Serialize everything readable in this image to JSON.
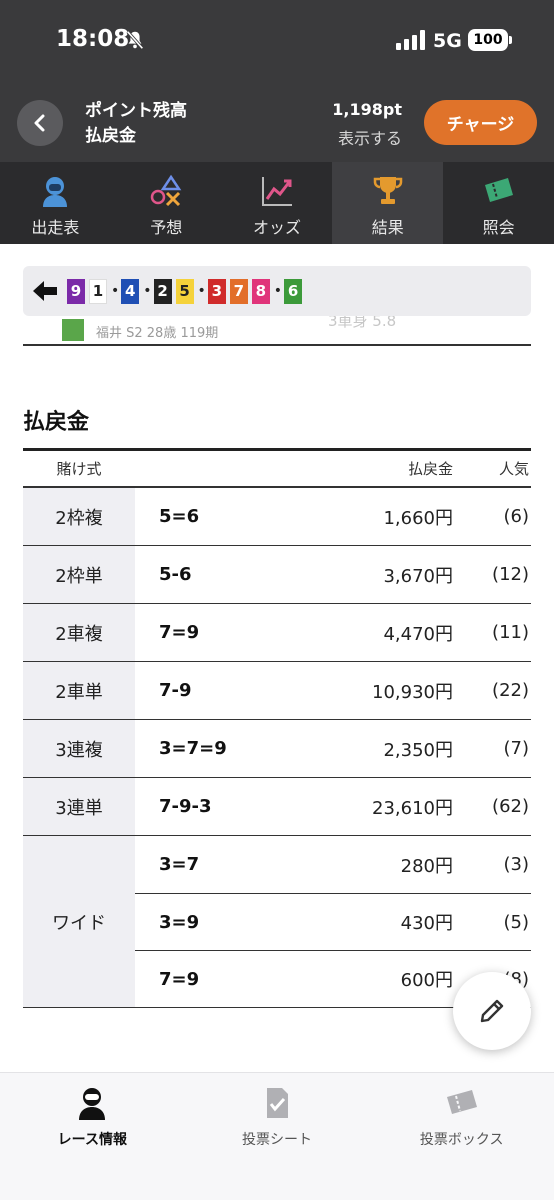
{
  "status_bar": {
    "time": "18:08",
    "network": "5G",
    "battery": "100"
  },
  "header": {
    "point_label": "ポイント残高",
    "payout_label": "払戻金",
    "points_value": "1,198pt",
    "show_label": "表示する",
    "charge_button": "チャージ"
  },
  "tabs": [
    {
      "label": "出走表",
      "icon": "racer-icon",
      "active": false
    },
    {
      "label": "予想",
      "icon": "prediction-icon",
      "active": false
    },
    {
      "label": "オッズ",
      "icon": "odds-chart-icon",
      "active": false
    },
    {
      "label": "結果",
      "icon": "trophy-icon",
      "active": true
    },
    {
      "label": "照会",
      "icon": "ticket-icon",
      "active": false
    }
  ],
  "order_strip": {
    "chips": [
      {
        "n": "9",
        "bg": "#7b2aa8",
        "fg": "#ffffff"
      },
      {
        "n": "1",
        "bg": "#ffffff",
        "fg": "#222222"
      },
      {
        "n": "4",
        "bg": "#1f4fb4",
        "fg": "#ffffff"
      },
      {
        "n": "2",
        "bg": "#222222",
        "fg": "#ffffff"
      },
      {
        "n": "5",
        "bg": "#f5d23a",
        "fg": "#222222"
      },
      {
        "n": "3",
        "bg": "#d02b2b",
        "fg": "#ffffff"
      },
      {
        "n": "7",
        "bg": "#e26e2a",
        "fg": "#ffffff"
      },
      {
        "n": "8",
        "bg": "#e0347a",
        "fg": "#ffffff"
      },
      {
        "n": "6",
        "bg": "#3c9a3a",
        "fg": "#ffffff"
      }
    ],
    "dot_after": [
      1,
      2,
      4,
      7
    ]
  },
  "behind_row": {
    "text": "福井 S2 28歳 119期",
    "ghost_text": "3車身            5.8"
  },
  "payout": {
    "title": "払戻金",
    "headers": {
      "type": "賭け式",
      "payout": "払戻金",
      "popularity": "人気"
    },
    "groups": [
      {
        "type": "2枠複",
        "rows": [
          {
            "combo": "5=6",
            "payout": "1,660円",
            "pop": "(6)"
          }
        ]
      },
      {
        "type": "2枠単",
        "rows": [
          {
            "combo": "5-6",
            "payout": "3,670円",
            "pop": "(12)"
          }
        ]
      },
      {
        "type": "2車複",
        "rows": [
          {
            "combo": "7=9",
            "payout": "4,470円",
            "pop": "(11)"
          }
        ]
      },
      {
        "type": "2車単",
        "rows": [
          {
            "combo": "7-9",
            "payout": "10,930円",
            "pop": "(22)"
          }
        ]
      },
      {
        "type": "3連複",
        "rows": [
          {
            "combo": "3=7=9",
            "payout": "2,350円",
            "pop": "(7)"
          }
        ]
      },
      {
        "type": "3連単",
        "rows": [
          {
            "combo": "7-9-3",
            "payout": "23,610円",
            "pop": "(62)"
          }
        ]
      },
      {
        "type": "ワイド",
        "rows": [
          {
            "combo": "3=7",
            "payout": "280円",
            "pop": "(3)"
          },
          {
            "combo": "3=9",
            "payout": "430円",
            "pop": "(5)"
          },
          {
            "combo": "7=9",
            "payout": "600円",
            "pop": "(8)"
          }
        ]
      }
    ]
  },
  "bottom_nav": [
    {
      "label": "レース情報",
      "icon": "race-info-icon",
      "active": true
    },
    {
      "label": "投票シート",
      "icon": "vote-sheet-icon",
      "active": false
    },
    {
      "label": "投票ボックス",
      "icon": "vote-box-icon",
      "active": false
    }
  ],
  "colors": {
    "accent": "#e0732a",
    "header_bg": "#3a3a3c",
    "tab_bg": "#2b2b2d"
  }
}
